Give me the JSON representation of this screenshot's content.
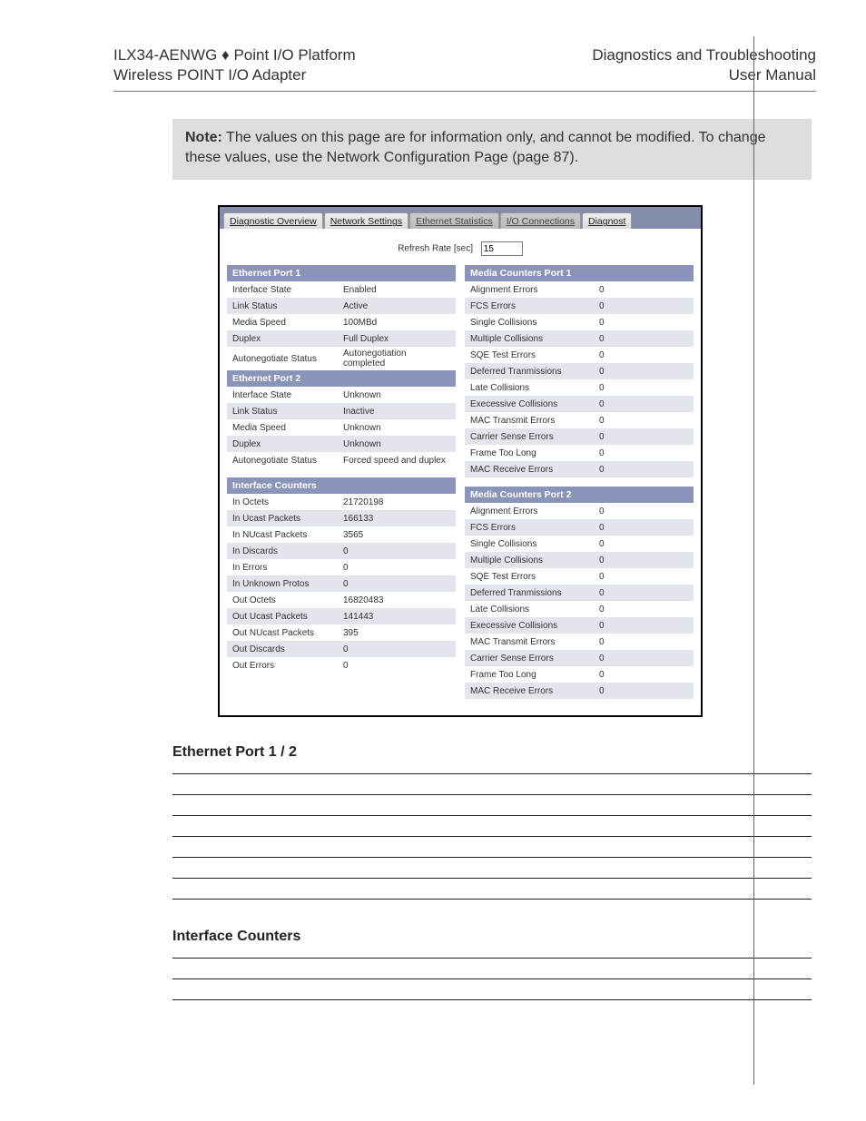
{
  "header": {
    "left1_prefix": "ILX34-AENWG ",
    "left1_sep": "♦",
    "left1_suffix": " Point I/O Platform",
    "left2": "Wireless POINT I/O Adapter",
    "right1": "Diagnostics and Troubleshooting",
    "right2": "User Manual"
  },
  "note": {
    "label": "Note:",
    "text": " The values on this page are for information only, and cannot be modified. To change these values, use the Network Configuration Page (page 87)."
  },
  "tabs": {
    "t0": "Diagnostic Overview",
    "t1": "Network Settings",
    "t2": "Ethernet Statistics",
    "t3": "I/O Connections",
    "t4": "Diagnost"
  },
  "refresh": {
    "label": "Refresh Rate [sec]",
    "value": "15"
  },
  "left_groups": {
    "g0": {
      "title": "Ethernet Port 1",
      "rows": {
        "r0": {
          "k": "Interface State",
          "v": "Enabled"
        },
        "r1": {
          "k": "Link Status",
          "v": "Active"
        },
        "r2": {
          "k": "Media Speed",
          "v": "100MBd"
        },
        "r3": {
          "k": "Duplex",
          "v": "Full Duplex"
        },
        "r4": {
          "k": "Autonegotiate Status",
          "v": "Autonegotiation completed"
        }
      }
    },
    "g1": {
      "title": "Ethernet Port 2",
      "rows": {
        "r0": {
          "k": "Interface State",
          "v": "Unknown"
        },
        "r1": {
          "k": "Link Status",
          "v": "Inactive"
        },
        "r2": {
          "k": "Media Speed",
          "v": "Unknown"
        },
        "r3": {
          "k": "Duplex",
          "v": "Unknown"
        },
        "r4": {
          "k": "Autonegotiate Status",
          "v": "Forced speed and duplex"
        }
      }
    },
    "g2": {
      "title": "Interface Counters",
      "rows": {
        "r0": {
          "k": "In Octets",
          "v": "21720198"
        },
        "r1": {
          "k": "In Ucast Packets",
          "v": "166133"
        },
        "r2": {
          "k": "In NUcast Packets",
          "v": "3565"
        },
        "r3": {
          "k": "In Discards",
          "v": "0"
        },
        "r4": {
          "k": "In Errors",
          "v": "0"
        },
        "r5": {
          "k": "In Unknown Protos",
          "v": "0"
        },
        "r6": {
          "k": "Out Octets",
          "v": "16820483"
        },
        "r7": {
          "k": "Out Ucast Packets",
          "v": "141443"
        },
        "r8": {
          "k": "Out NUcast Packets",
          "v": "395"
        },
        "r9": {
          "k": "Out Discards",
          "v": "0"
        },
        "r10": {
          "k": "Out Errors",
          "v": "0"
        }
      }
    }
  },
  "right_groups": {
    "g0": {
      "title": "Media Counters Port 1",
      "rows": {
        "r0": {
          "k": "Alignment Errors",
          "v": "0"
        },
        "r1": {
          "k": "FCS Errors",
          "v": "0"
        },
        "r2": {
          "k": "Single Collisions",
          "v": "0"
        },
        "r3": {
          "k": "Multiple Collisions",
          "v": "0"
        },
        "r4": {
          "k": "SQE Test Errors",
          "v": "0"
        },
        "r5": {
          "k": "Deferred Tranmissions",
          "v": "0"
        },
        "r6": {
          "k": "Late Collisions",
          "v": "0"
        },
        "r7": {
          "k": "Execessive Collisions",
          "v": "0"
        },
        "r8": {
          "k": "MAC Transmit Errors",
          "v": "0"
        },
        "r9": {
          "k": "Carrier Sense Errors",
          "v": "0"
        },
        "r10": {
          "k": "Frame Too Long",
          "v": "0"
        },
        "r11": {
          "k": "MAC Receive Errors",
          "v": "0"
        }
      }
    },
    "g1": {
      "title": "Media Counters Port 2",
      "rows": {
        "r0": {
          "k": "Alignment Errors",
          "v": "0"
        },
        "r1": {
          "k": "FCS Errors",
          "v": "0"
        },
        "r2": {
          "k": "Single Collisions",
          "v": "0"
        },
        "r3": {
          "k": "Multiple Collisions",
          "v": "0"
        },
        "r4": {
          "k": "SQE Test Errors",
          "v": "0"
        },
        "r5": {
          "k": "Deferred Tranmissions",
          "v": "0"
        },
        "r6": {
          "k": "Late Collisions",
          "v": "0"
        },
        "r7": {
          "k": "Execessive Collisions",
          "v": "0"
        },
        "r8": {
          "k": "MAC Transmit Errors",
          "v": "0"
        },
        "r9": {
          "k": "Carrier Sense Errors",
          "v": "0"
        },
        "r10": {
          "k": "Frame Too Long",
          "v": "0"
        },
        "r11": {
          "k": "MAC Receive Errors",
          "v": "0"
        }
      }
    }
  },
  "sections": {
    "s1": "Ethernet Port 1 / 2",
    "s2": "Interface Counters"
  }
}
